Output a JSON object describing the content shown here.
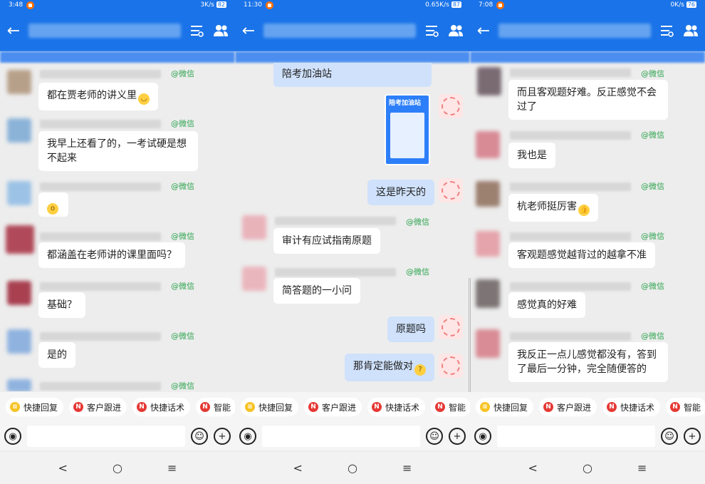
{
  "panels": [
    {
      "status": {
        "time": "3:48",
        "speed": "3K/s",
        "battery": "82"
      },
      "messages": [
        {
          "tag": "@微信",
          "text": "都在贾老师的讲义里",
          "emoji": "sweat-smile-emoji"
        },
        {
          "tag": "@微信",
          "text": "我早上还看了的，一考试硬是想\n不起来"
        },
        {
          "tag": "@微信",
          "text": "",
          "emoji": "surprised-emoji"
        },
        {
          "tag": "@微信",
          "text": "都涵盖在老师讲的课里面吗？"
        },
        {
          "tag": "@微信",
          "text": "基础？"
        },
        {
          "tag": "@微信",
          "text": "是的"
        },
        {
          "tag": "@微信",
          "text": ""
        }
      ]
    },
    {
      "status": {
        "time": "11:30",
        "speed": "0.65K/s",
        "battery": "87"
      },
      "messages": [
        {
          "text": "陪考加油站"
        },
        {
          "image_title": "陪考加油站"
        },
        {
          "text": "这是昨天的"
        },
        {
          "tag": "@微信",
          "text": "审计有应试指南原题"
        },
        {
          "tag": "@微信",
          "text": "简答题的一小问"
        },
        {
          "text": "原题吗"
        },
        {
          "text": "那肯定能做对",
          "emoji": "thinking-emoji"
        }
      ]
    },
    {
      "status": {
        "time": "7:08",
        "speed": "0K/s",
        "battery": "76"
      },
      "messages": [
        {
          "tag": "@微信",
          "text": "而且客观题好难。反正感觉不会\n过了"
        },
        {
          "tag": "@微信",
          "text": "我也是"
        },
        {
          "tag": "@微信",
          "text": "杭老师挺厉害",
          "emoji": "thumbs-up-emoji"
        },
        {
          "tag": "@微信",
          "text": "客观题感觉越背过的越拿不准"
        },
        {
          "tag": "@微信",
          "text": "感觉真的好难"
        },
        {
          "tag": "@微信",
          "text": "我反正一点儿感觉都没有，答到\n了最后一分钟，完全随便答的"
        }
      ]
    }
  ],
  "toolbar": {
    "quick_reply": "快捷回复",
    "customer_follow": "客户跟进",
    "quick_script": "快捷话术",
    "smart": "智能"
  },
  "nav": {
    "back": "<",
    "home": "○",
    "menu": "≡"
  },
  "colors": {
    "header": "#1a73e8",
    "bubble_mine": "#cfe1fb",
    "tag": "#2ea44f"
  }
}
